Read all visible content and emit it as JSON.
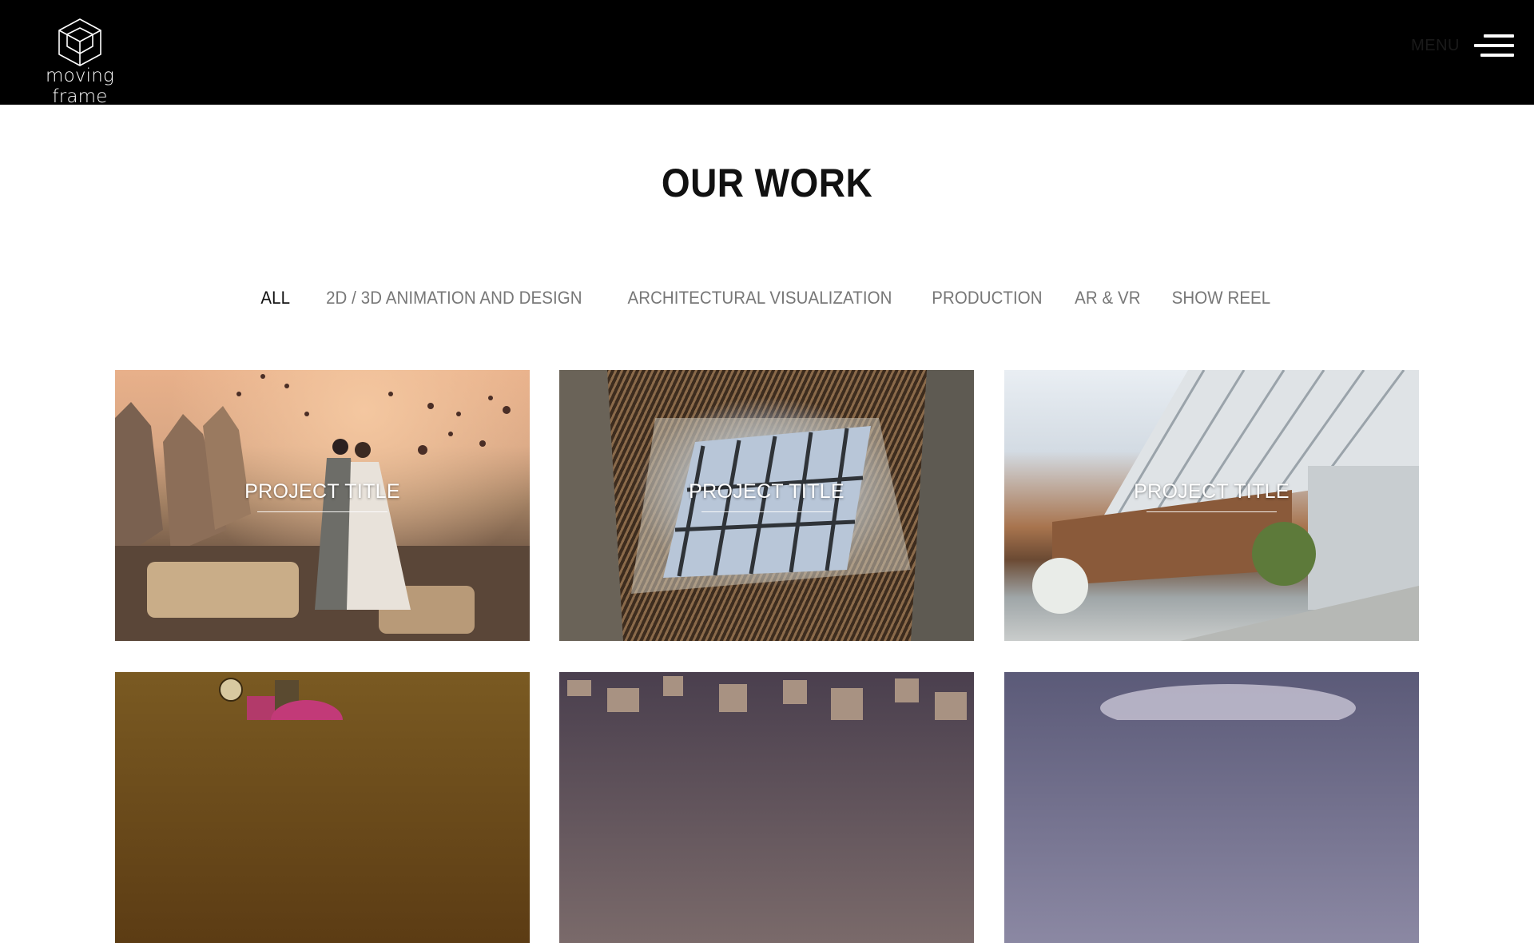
{
  "header": {
    "logo_text": "moving frame",
    "menu_label": "MENU"
  },
  "page": {
    "title": "OUR WORK"
  },
  "filters": [
    {
      "label": "ALL",
      "active": true
    },
    {
      "label": "2D / 3D ANIMATION AND DESIGN",
      "active": false
    },
    {
      "label": "ARCHITECTURAL VISUALIZATION",
      "active": false
    },
    {
      "label": "PRODUCTION",
      "active": false
    },
    {
      "label": "AR & VR",
      "active": false
    },
    {
      "label": "SHOW REEL",
      "active": false
    }
  ],
  "projects": [
    {
      "title": "PROJECT TITLE"
    },
    {
      "title": "PROJECT TITLE"
    },
    {
      "title": "PROJECT TITLE"
    },
    {
      "title": ""
    },
    {
      "title": ""
    },
    {
      "title": ""
    }
  ],
  "colors": {
    "header_bg": "#000000",
    "page_bg": "#ffffff",
    "filter_active": "#111111",
    "filter_inactive": "#777777"
  }
}
